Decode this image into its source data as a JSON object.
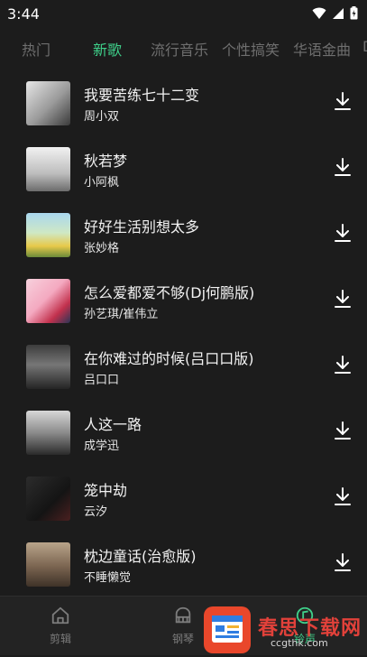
{
  "status": {
    "time": "3:44"
  },
  "tabs": [
    "热门",
    "新歌",
    "流行音乐",
    "个性搞笑",
    "华语金曲",
    "DJ"
  ],
  "songs": [
    {
      "title": "我要苦练七十二变",
      "artist": "周小双"
    },
    {
      "title": "秋若梦",
      "artist": "小阿枫"
    },
    {
      "title": "好好生活别想太多",
      "artist": "张妙格"
    },
    {
      "title": "怎么爱都爱不够(Dj何鹏版)",
      "artist": "孙艺琪/崔伟立"
    },
    {
      "title": "在你难过的时候(吕口口版)",
      "artist": "吕口口"
    },
    {
      "title": "人这一路",
      "artist": "成学迅"
    },
    {
      "title": "笼中劫",
      "artist": "云汐"
    },
    {
      "title": "枕边童话(治愈版)",
      "artist": "不睡懒觉"
    }
  ],
  "nav": {
    "edit": "剪辑",
    "piano": "钢琴",
    "ring": "铃声"
  },
  "watermark": {
    "brand": "春思下载网",
    "url": "ccgthk.com"
  },
  "colors": {
    "accent": "#3ed08a",
    "background": "#1c1c1c"
  }
}
